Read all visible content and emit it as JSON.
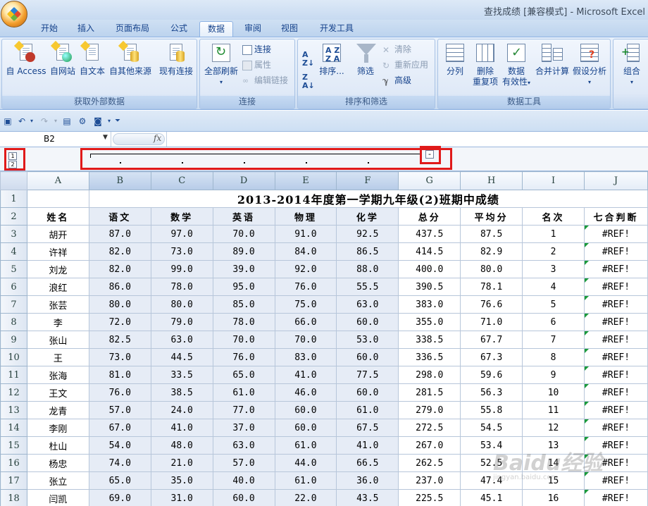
{
  "window": {
    "title": "查找成绩  [兼容模式] - Microsoft Excel"
  },
  "ribbon": {
    "tabs": [
      {
        "label": "开始"
      },
      {
        "label": "插入"
      },
      {
        "label": "页面布局"
      },
      {
        "label": "公式"
      },
      {
        "label": "数据",
        "active": true
      },
      {
        "label": "审阅"
      },
      {
        "label": "视图"
      },
      {
        "label": "开发工具"
      }
    ],
    "groups": {
      "external": {
        "label": "获取外部数据",
        "buttons": {
          "access": "自 Access",
          "web": "自网站",
          "text": "自文本",
          "other": "自其他来源",
          "existing": "现有连接"
        }
      },
      "connections": {
        "label": "连接",
        "refresh_all": "全部刷新",
        "connections": "连接",
        "properties": "属性",
        "edit_links": "编辑链接"
      },
      "sort_filter": {
        "label": "排序和筛选",
        "sort": "排序...",
        "filter": "筛选",
        "clear": "清除",
        "reapply": "重新应用",
        "advanced": "高级"
      },
      "data_tools": {
        "label": "数据工具",
        "split": "分列",
        "remove_dup_1": "删除",
        "remove_dup_2": "重复项",
        "validation_1": "数据",
        "validation_2": "有效性",
        "consolidate": "合并计算",
        "what_if": "假设分析"
      },
      "outline": {
        "group": "组合"
      }
    }
  },
  "formula_bar": {
    "name_box": "B2",
    "fx": "fx",
    "value": ""
  },
  "outline_bar": {
    "levels": [
      "1",
      "2"
    ],
    "collapse_symbol": "-"
  },
  "sheet": {
    "columns": [
      "A",
      "B",
      "C",
      "D",
      "E",
      "F",
      "G",
      "H",
      "I",
      "J"
    ],
    "title": "2013-2014年度第一学期九年级(2)班期中成绩",
    "headers": [
      "姓名",
      "语文",
      "数学",
      "英语",
      "物理",
      "化学",
      "总分",
      "平均分",
      "名次",
      "七合判断"
    ],
    "rows": [
      [
        "胡开",
        "87.0",
        "97.0",
        "70.0",
        "91.0",
        "92.5",
        "437.5",
        "87.5",
        "1",
        "#REF!"
      ],
      [
        "许祥",
        "82.0",
        "73.0",
        "89.0",
        "84.0",
        "86.5",
        "414.5",
        "82.9",
        "2",
        "#REF!"
      ],
      [
        "刘龙",
        "82.0",
        "99.0",
        "39.0",
        "92.0",
        "88.0",
        "400.0",
        "80.0",
        "3",
        "#REF!"
      ],
      [
        "浪红",
        "86.0",
        "78.0",
        "95.0",
        "76.0",
        "55.5",
        "390.5",
        "78.1",
        "4",
        "#REF!"
      ],
      [
        "张芸",
        "80.0",
        "80.0",
        "85.0",
        "75.0",
        "63.0",
        "383.0",
        "76.6",
        "5",
        "#REF!"
      ],
      [
        "李",
        "72.0",
        "79.0",
        "78.0",
        "66.0",
        "60.0",
        "355.0",
        "71.0",
        "6",
        "#REF!"
      ],
      [
        "张山",
        "82.5",
        "63.0",
        "70.0",
        "70.0",
        "53.0",
        "338.5",
        "67.7",
        "7",
        "#REF!"
      ],
      [
        "王",
        "73.0",
        "44.5",
        "76.0",
        "83.0",
        "60.0",
        "336.5",
        "67.3",
        "8",
        "#REF!"
      ],
      [
        "张海",
        "81.0",
        "33.5",
        "65.0",
        "41.0",
        "77.5",
        "298.0",
        "59.6",
        "9",
        "#REF!"
      ],
      [
        "王文",
        "76.0",
        "38.5",
        "61.0",
        "46.0",
        "60.0",
        "281.5",
        "56.3",
        "10",
        "#REF!"
      ],
      [
        "龙青",
        "57.0",
        "24.0",
        "77.0",
        "60.0",
        "61.0",
        "279.0",
        "55.8",
        "11",
        "#REF!"
      ],
      [
        "李刚",
        "67.0",
        "41.0",
        "37.0",
        "60.0",
        "67.5",
        "272.5",
        "54.5",
        "12",
        "#REF!"
      ],
      [
        "杜山",
        "54.0",
        "48.0",
        "63.0",
        "61.0",
        "41.0",
        "267.0",
        "53.4",
        "13",
        "#REF!"
      ],
      [
        "杨忠",
        "74.0",
        "21.0",
        "57.0",
        "44.0",
        "66.5",
        "262.5",
        "52.5",
        "14",
        "#REF!"
      ],
      [
        "张立",
        "65.0",
        "35.0",
        "40.0",
        "61.0",
        "36.0",
        "237.0",
        "47.4",
        "15",
        "#REF!"
      ],
      [
        "闫凯",
        "69.0",
        "31.0",
        "60.0",
        "22.0",
        "43.5",
        "225.5",
        "45.1",
        "16",
        "#REF!"
      ]
    ]
  },
  "watermark": {
    "brand": "Baidu经验",
    "url": "jingyan.baidu.com"
  }
}
